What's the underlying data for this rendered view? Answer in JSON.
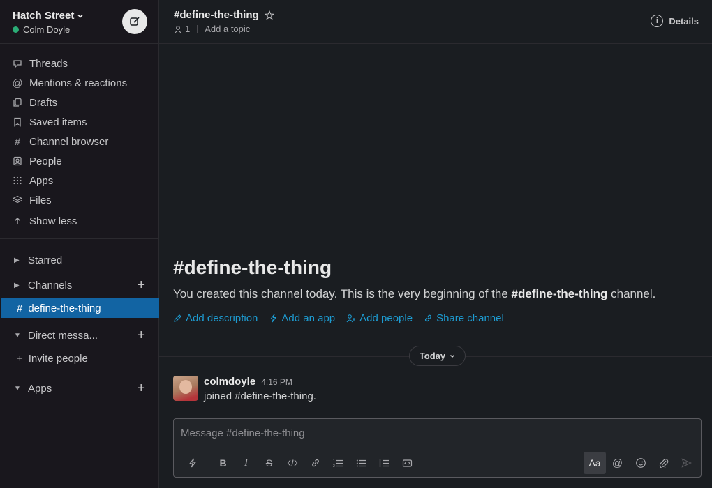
{
  "workspace": {
    "name": "Hatch Street",
    "user": "Colm Doyle"
  },
  "nav": [
    {
      "label": "Threads",
      "icon": "threads-icon"
    },
    {
      "label": "Mentions & reactions",
      "icon": "at-icon"
    },
    {
      "label": "Drafts",
      "icon": "drafts-icon"
    },
    {
      "label": "Saved items",
      "icon": "bookmark-icon"
    },
    {
      "label": "Channel browser",
      "icon": "channel-browser-icon"
    },
    {
      "label": "People",
      "icon": "people-icon"
    },
    {
      "label": "Apps",
      "icon": "apps-grid-icon"
    },
    {
      "label": "Files",
      "icon": "files-icon"
    },
    {
      "label": "Show less",
      "icon": "arrow-up-icon"
    }
  ],
  "sections": {
    "starred": "Starred",
    "channels": "Channels",
    "active_channel": "define-the-thing",
    "direct_messages": "Direct messa...",
    "invite": "Invite people",
    "apps": "Apps"
  },
  "channel": {
    "name": "#define-the-thing",
    "members": "1",
    "topic": "Add a topic",
    "details": "Details"
  },
  "intro": {
    "title": "#define-the-thing",
    "text_before": "You created this channel today. This is the very beginning of the ",
    "text_channel": "#define-the-thing",
    "text_after": " channel.",
    "actions": [
      "Add description",
      "Add an app",
      "Add people",
      "Share channel"
    ]
  },
  "day_divider": "Today",
  "message": {
    "user": "colmdoyle",
    "time": "4:16 PM",
    "text": "joined #define-the-thing."
  },
  "composer": {
    "placeholder": "Message #define-the-thing",
    "format_label": "Aa"
  },
  "colors": {
    "accent": "#1264a3",
    "link": "#1d9bd1",
    "online": "#2bac76"
  }
}
